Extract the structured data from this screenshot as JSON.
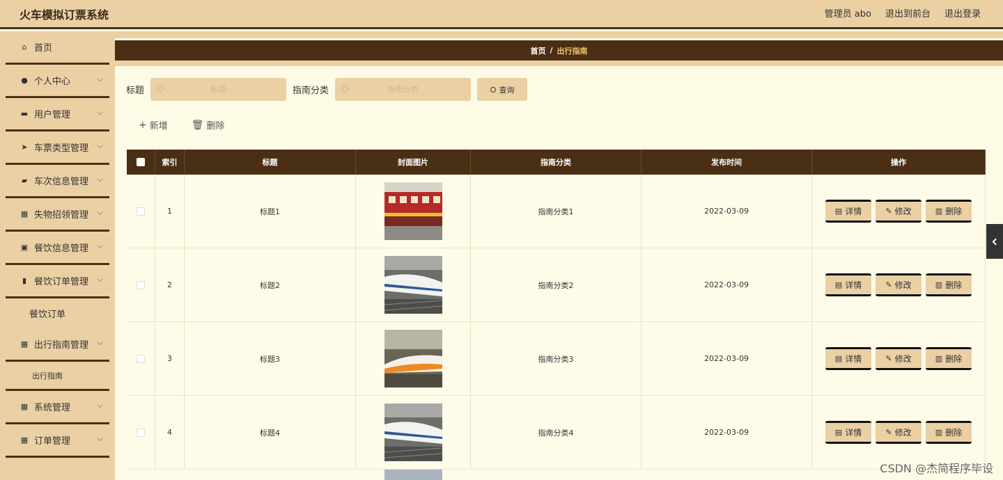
{
  "header": {
    "title": "火车模拟订票系统",
    "admin": "管理员 abo",
    "to_front": "退出到前台",
    "logout": "退出登录"
  },
  "sidebar": {
    "items": [
      {
        "label": "首页",
        "icon": "home-icon"
      },
      {
        "label": "个人中心",
        "icon": "user-icon"
      },
      {
        "label": "用户管理",
        "icon": "briefcase-icon"
      },
      {
        "label": "车票类型管理",
        "icon": "paper-plane-icon"
      },
      {
        "label": "车次信息管理",
        "icon": "ticket-icon"
      },
      {
        "label": "失物招领管理",
        "icon": "grid-icon"
      },
      {
        "label": "餐饮信息管理",
        "icon": "clipboard-icon"
      },
      {
        "label": "餐饮订单管理",
        "icon": "bar-chart-icon"
      }
    ],
    "sub_dining": "餐饮订单",
    "item_guide": "出行指南管理",
    "sub_guide": "出行指南",
    "item_system": "系统管理",
    "item_orders": "订单管理"
  },
  "breadcrumb": {
    "home": "首页",
    "sep": "/",
    "current": "出行指南"
  },
  "search": {
    "title_label": "标题",
    "title_placeholder": "标题",
    "category_label": "指南分类",
    "category_placeholder": "指南分类",
    "query_button": "查询"
  },
  "actions": {
    "add": "新增",
    "delete": "删除"
  },
  "table": {
    "headers": [
      "索引",
      "标题",
      "封面图片",
      "指南分类",
      "发布时间",
      "操作"
    ],
    "rows": [
      {
        "index": "1",
        "title": "标题1",
        "category": "指南分类1",
        "date": "2022-03-09"
      },
      {
        "index": "2",
        "title": "标题2",
        "category": "指南分类2",
        "date": "2022-03-09"
      },
      {
        "index": "3",
        "title": "标题3",
        "category": "指南分类3",
        "date": "2022-03-09"
      },
      {
        "index": "4",
        "title": "标题4",
        "category": "指南分类4",
        "date": "2022-03-09"
      }
    ],
    "op_detail": "详情",
    "op_edit": "修改",
    "op_delete": "删除"
  },
  "watermark": "CSDN @杰简程序毕设",
  "colors": {
    "accent": "#ebd0a4",
    "dark": "#4a2f15",
    "background": "#fdfbe6"
  }
}
